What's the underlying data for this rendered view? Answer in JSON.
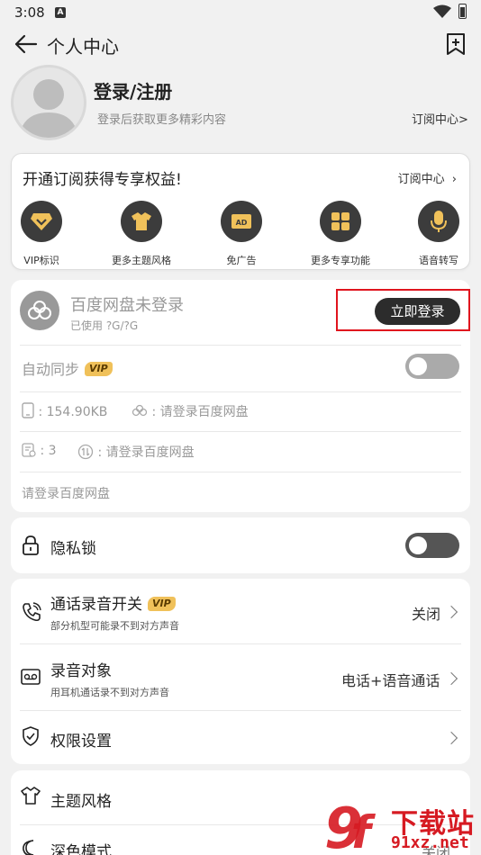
{
  "status_bar": {
    "time": "3:08",
    "notif_letter": "A"
  },
  "header": {
    "title": "个人中心"
  },
  "profile": {
    "login_title": "登录/注册",
    "login_subtitle": "登录后获取更多精彩内容",
    "subscription_link": "订阅中心>"
  },
  "promo": {
    "title": "开通订阅获得专享权益!",
    "link": "订阅中心",
    "features": [
      {
        "label": "VIP标识",
        "icon": "vip-badge-icon"
      },
      {
        "label": "更多主题风格",
        "icon": "shirt-icon"
      },
      {
        "label": "免广告",
        "icon": "ad-icon"
      },
      {
        "label": "更多专享功能",
        "icon": "grid-icon"
      },
      {
        "label": "语音转写",
        "icon": "microphone-icon"
      }
    ]
  },
  "cloud": {
    "title": "百度网盘未登录",
    "used": "已使用 ?G/?G",
    "login_button": "立即登录",
    "auto_sync_label": "自动同步",
    "vip_tag": "VIP",
    "local_size": ": 154.90KB",
    "cloud_size": ": 请登录百度网盘",
    "local_count": ": 3",
    "cloud_count": ": 请登录百度网盘",
    "footer_hint": "请登录百度网盘"
  },
  "privacy": {
    "label": "隐私锁"
  },
  "settings": {
    "call_recording": {
      "title": "通话录音开关",
      "vip_tag": "VIP",
      "subtitle": "部分机型可能录不到对方声音",
      "value": "关闭"
    },
    "recording_target": {
      "title": "录音对象",
      "subtitle": "用耳机通话录不到对方声音",
      "value": "电话+语音通话"
    },
    "permissions": {
      "title": "权限设置"
    }
  },
  "theme": {
    "title": "主题风格",
    "dark_mode": "深色模式",
    "dark_mode_value": "关闭"
  },
  "watermark": {
    "text": "下载站",
    "url": "91xz.net"
  }
}
